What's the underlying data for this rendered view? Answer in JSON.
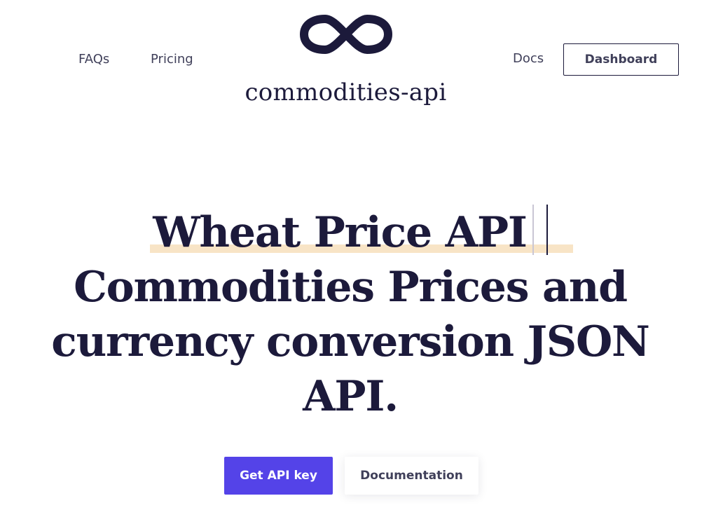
{
  "nav": {
    "faqs": "FAQs",
    "pricing": "Pricing",
    "docs": "Docs",
    "dashboard": "Dashboard"
  },
  "brand": {
    "name": "commodities-api",
    "logo_icon": "infinity-icon"
  },
  "hero": {
    "typed_text": "Wheat Price API",
    "line2": "Commodities Prices and",
    "line3": "currency conversion JSON",
    "line4": "API."
  },
  "cta": {
    "primary": "Get API key",
    "secondary": "Documentation"
  },
  "colors": {
    "text": "#1c1a3b",
    "accent": "#5443e8",
    "highlight": "#f8e4c6"
  }
}
